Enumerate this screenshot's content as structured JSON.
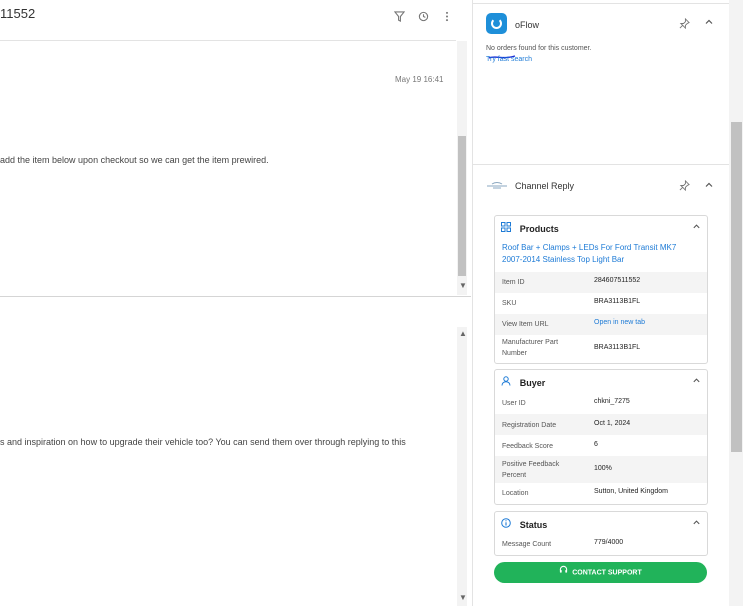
{
  "ticket": {
    "id_fragment": "11552"
  },
  "header_icons": {
    "filter": "filter-icon",
    "history": "history-icon",
    "more": "more-vertical-icon"
  },
  "messages": [
    {
      "time": "May 19 16:41",
      "text": "add the item below upon checkout so we can get the item prewired."
    },
    {
      "time": "",
      "text": "s and inspiration on how to upgrade their vehicle too? You can send them over through replying to this"
    }
  ],
  "oflow": {
    "title": "oFlow",
    "no_orders": "No orders found for this customer.",
    "fast_search": "Try fast search"
  },
  "channel_reply": {
    "title": "Channel Reply",
    "products": {
      "heading": "Products",
      "title": "Roof Bar + Clamps + LEDs For Ford Transit MK7 2007-2014 Stainless Top Light Bar",
      "rows": [
        {
          "label": "Item ID",
          "value": "284607511552"
        },
        {
          "label": "SKU",
          "value": "BRA3113B1FL"
        },
        {
          "label": "View Item URL",
          "value": "Open in new tab"
        },
        {
          "label": "Manufacturer Part Number",
          "value": "BRA3113B1FL"
        }
      ]
    },
    "buyer": {
      "heading": "Buyer",
      "rows": [
        {
          "label": "User ID",
          "value": "chkni_7275"
        },
        {
          "label": "Registration Date",
          "value": "Oct 1, 2024"
        },
        {
          "label": "Feedback Score",
          "value": "6"
        },
        {
          "label": "Positive Feedback Percent",
          "value": "100%"
        },
        {
          "label": "Location",
          "value": "Sutton, United Kingdom"
        }
      ]
    },
    "status": {
      "heading": "Status",
      "rows": [
        {
          "label": "Message Count",
          "value": "779/4000"
        }
      ]
    },
    "contact_support": "CONTACT SUPPORT"
  },
  "colors": {
    "accent": "#1e7bd6",
    "support_button": "#21b35a",
    "oflow_brand": "#1e8fd9"
  }
}
